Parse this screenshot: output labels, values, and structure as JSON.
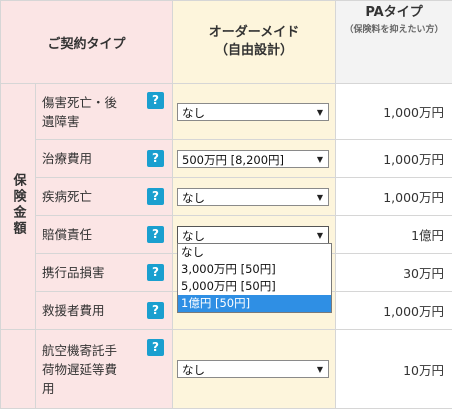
{
  "header": {
    "type_label": "ご契約タイプ",
    "om_line1": "オーダーメイド",
    "om_line2": "（自由設計）",
    "pa_title": "PAタイプ",
    "pa_sub": "（保険料を抑えたい方）"
  },
  "group_label": "保険金額",
  "help_glyph": "?",
  "rows": [
    {
      "label": "傷害死亡・後遺障害",
      "select": "なし",
      "pa": "1,000万円"
    },
    {
      "label": "治療費用",
      "select": "500万円 [8,200円]",
      "pa": "1,000万円"
    },
    {
      "label": "疾病死亡",
      "select": "なし",
      "pa": "1,000万円"
    },
    {
      "label": "賠償責任",
      "select": "なし",
      "pa": "1億円"
    },
    {
      "label": "携行品損害",
      "select": "",
      "pa": "30万円"
    },
    {
      "label": "救援者費用",
      "select": "",
      "pa": "1,000万円"
    },
    {
      "label": "航空機寄託手荷物遅延等費用",
      "select": "なし",
      "pa": "10万円"
    }
  ],
  "dropdown": {
    "options": [
      "なし",
      "3,000万円 [50円]",
      "5,000万円 [50円]",
      "1億円 [50円]"
    ],
    "highlighted": "1億円 [50円]"
  },
  "colors": {
    "pink": "#fbe5e5",
    "cream": "#fdf5dc",
    "help": "#1a9fcf",
    "highlight": "#2f8fe4"
  }
}
